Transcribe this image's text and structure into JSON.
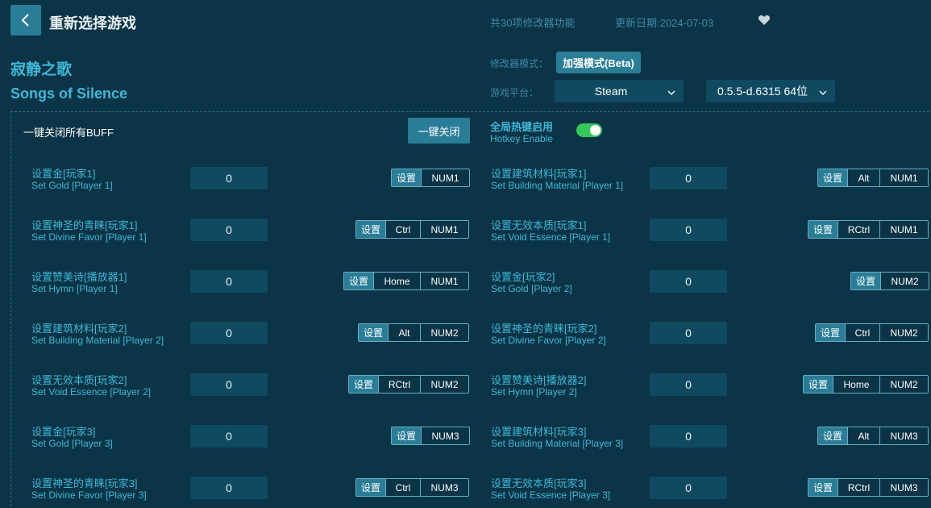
{
  "header": {
    "title": "重新选择游戏",
    "feature_count": "共30项修改器功能",
    "update_date": "更新日期:2024-07-03"
  },
  "game": {
    "name_cn": "寂静之歌",
    "name_en": "Songs of Silence"
  },
  "settings": {
    "mode_label": "修改器模式：",
    "mode_value": "加强模式(Beta)",
    "platform_label": "游戏平台：",
    "platform_value": "Steam",
    "version_value": "0.5.5-d.6315 64位"
  },
  "controls": {
    "all_off_label": "一键关闭所有BUFF",
    "all_off_button": "一键关闭",
    "hotkey_cn": "全局热键启用",
    "hotkey_en": "Hotkey Enable",
    "hotkey_enabled": true
  },
  "set_label": "设置",
  "rows": [
    {
      "cn": "设置金[玩家1]",
      "en": "Set Gold [Player 1]",
      "value": "0",
      "keys": [
        "NUM1"
      ]
    },
    {
      "cn": "设置建筑材料[玩家1]",
      "en": "Set Building Material [Player 1]",
      "value": "0",
      "keys": [
        "Alt",
        "NUM1"
      ]
    },
    {
      "cn": "设置神圣的青睐[玩家1]",
      "en": "Set Divine Favor [Player 1]",
      "value": "0",
      "keys": [
        "Ctrl",
        "NUM1"
      ]
    },
    {
      "cn": "设置无效本质[玩家1]",
      "en": "Set Void Essence [Player 1]",
      "value": "0",
      "keys": [
        "RCtrl",
        "NUM1"
      ]
    },
    {
      "cn": "设置赞美诗[播放器1]",
      "en": "Set Hymn [Player 1]",
      "value": "0",
      "keys": [
        "Home",
        "NUM1"
      ]
    },
    {
      "cn": "设置金[玩家2]",
      "en": "Set Gold [Player 2]",
      "value": "0",
      "keys": [
        "NUM2"
      ]
    },
    {
      "cn": "设置建筑材料[玩家2]",
      "en": "Set Building Material [Player 2]",
      "value": "0",
      "keys": [
        "Alt",
        "NUM2"
      ]
    },
    {
      "cn": "设置神圣的青睐[玩家2]",
      "en": "Set Divine Favor [Player 2]",
      "value": "0",
      "keys": [
        "Ctrl",
        "NUM2"
      ]
    },
    {
      "cn": "设置无效本质[玩家2]",
      "en": "Set Void Essence [Player 2]",
      "value": "0",
      "keys": [
        "RCtrl",
        "NUM2"
      ]
    },
    {
      "cn": "设置赞美诗[播放器2]",
      "en": "Set Hymn [Player 2]",
      "value": "0",
      "keys": [
        "Home",
        "NUM2"
      ]
    },
    {
      "cn": "设置金[玩家3]",
      "en": "Set Gold [Player 3]",
      "value": "0",
      "keys": [
        "NUM3"
      ]
    },
    {
      "cn": "设置建筑材料[玩家3]",
      "en": "Set Building Material [Player 3]",
      "value": "0",
      "keys": [
        "Alt",
        "NUM3"
      ]
    },
    {
      "cn": "设置神圣的青睐[玩家3]",
      "en": "Set Divine Favor [Player 3]",
      "value": "0",
      "keys": [
        "Ctrl",
        "NUM3"
      ]
    },
    {
      "cn": "设置无效本质[玩家3]",
      "en": "Set Void Essence [Player 3]",
      "value": "0",
      "keys": [
        "RCtrl",
        "NUM3"
      ]
    }
  ]
}
